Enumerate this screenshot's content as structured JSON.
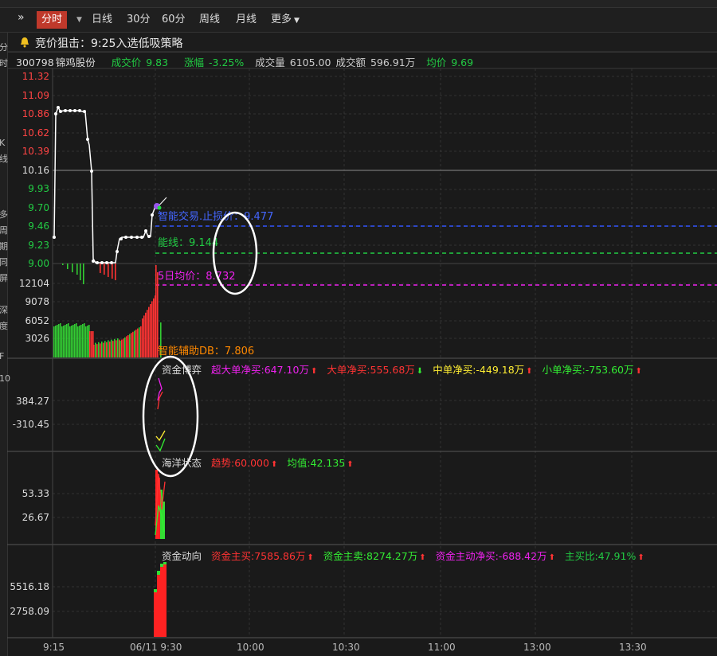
{
  "toolbar": {
    "items": [
      "分时",
      "日线",
      "30分",
      "60分",
      "周线",
      "月线",
      "更多"
    ]
  },
  "strategy": {
    "text": "竞价狙击：9:25入选低吸策略"
  },
  "left_sidebar": [
    "分",
    "时",
    "K",
    "线",
    "多",
    "周",
    "期",
    "同",
    "屏",
    "深",
    "度",
    "F",
    "10"
  ],
  "stock": {
    "code": "300798",
    "name": "锦鸡股份",
    "price_label": "成交价",
    "price": "9.83",
    "change_label": "涨幅",
    "change": "-3.25%",
    "volume_label": "成交量",
    "volume": "6105.00",
    "amount_label": "成交额",
    "amount": "596.91万",
    "avg_label": "均价",
    "avg": "9.69"
  },
  "main_chart": {
    "price_ticks": [
      "11.32",
      "11.09",
      "10.86",
      "10.62",
      "10.39",
      "10.16",
      "9.93",
      "9.70",
      "9.46",
      "9.23",
      "9.00"
    ],
    "volume_ticks": [
      "12104",
      "9078",
      "6052",
      "3026"
    ],
    "annotations": {
      "stop_loss": "智能交易.止损价：9.477",
      "energy_line": "能线：9.144",
      "ma5": "5日均价：8.732",
      "assist": "智能辅助DB：7.806"
    },
    "colors": {
      "up": "#ff3333",
      "down": "#33cc33",
      "stop": "#3355ff",
      "energy": "#22cc44",
      "ma5": "#ee22ee",
      "assist": "#ff8800"
    }
  },
  "fund_game": {
    "title": "资金博弈",
    "ticks": [
      "384.27",
      "-310.45"
    ],
    "items": [
      {
        "text": "超大单净买:647.10万",
        "color": "#ee22ee",
        "arrow": "up"
      },
      {
        "text": "大单净买:555.68万",
        "color": "#ff3333",
        "arrow": "down"
      },
      {
        "text": "中单净买:-449.18万",
        "color": "#ffee33",
        "arrow": "up"
      },
      {
        "text": "小单净买:-753.60万",
        "color": "#33ee33",
        "arrow": "up"
      }
    ]
  },
  "ocean": {
    "title": "海洋状态",
    "ticks": [
      "53.33",
      "26.67"
    ],
    "items": [
      {
        "text": "趋势:60.000",
        "color": "#ff3333",
        "arrow": "up"
      },
      {
        "text": "均值:42.135",
        "color": "#33ee33",
        "arrow": "up"
      }
    ]
  },
  "fund_flow": {
    "title": "资金动向",
    "ticks": [
      "5516.18",
      "2758.09"
    ],
    "items": [
      {
        "text": "资金主买:7585.86万",
        "color": "#ff3333",
        "arrow": "up"
      },
      {
        "text": "资金主卖:8274.27万",
        "color": "#33ee33",
        "arrow": "up"
      },
      {
        "text": "资金主动净买:-688.42万",
        "color": "#ee22ee",
        "arrow": "up"
      },
      {
        "text": "主买比:47.91%",
        "color": "#22cc44",
        "arrow": "up"
      }
    ]
  },
  "time_axis": [
    "9:15",
    "06/11 9:30",
    "10:00",
    "10:30",
    "11:00",
    "13:00",
    "13:30"
  ]
}
